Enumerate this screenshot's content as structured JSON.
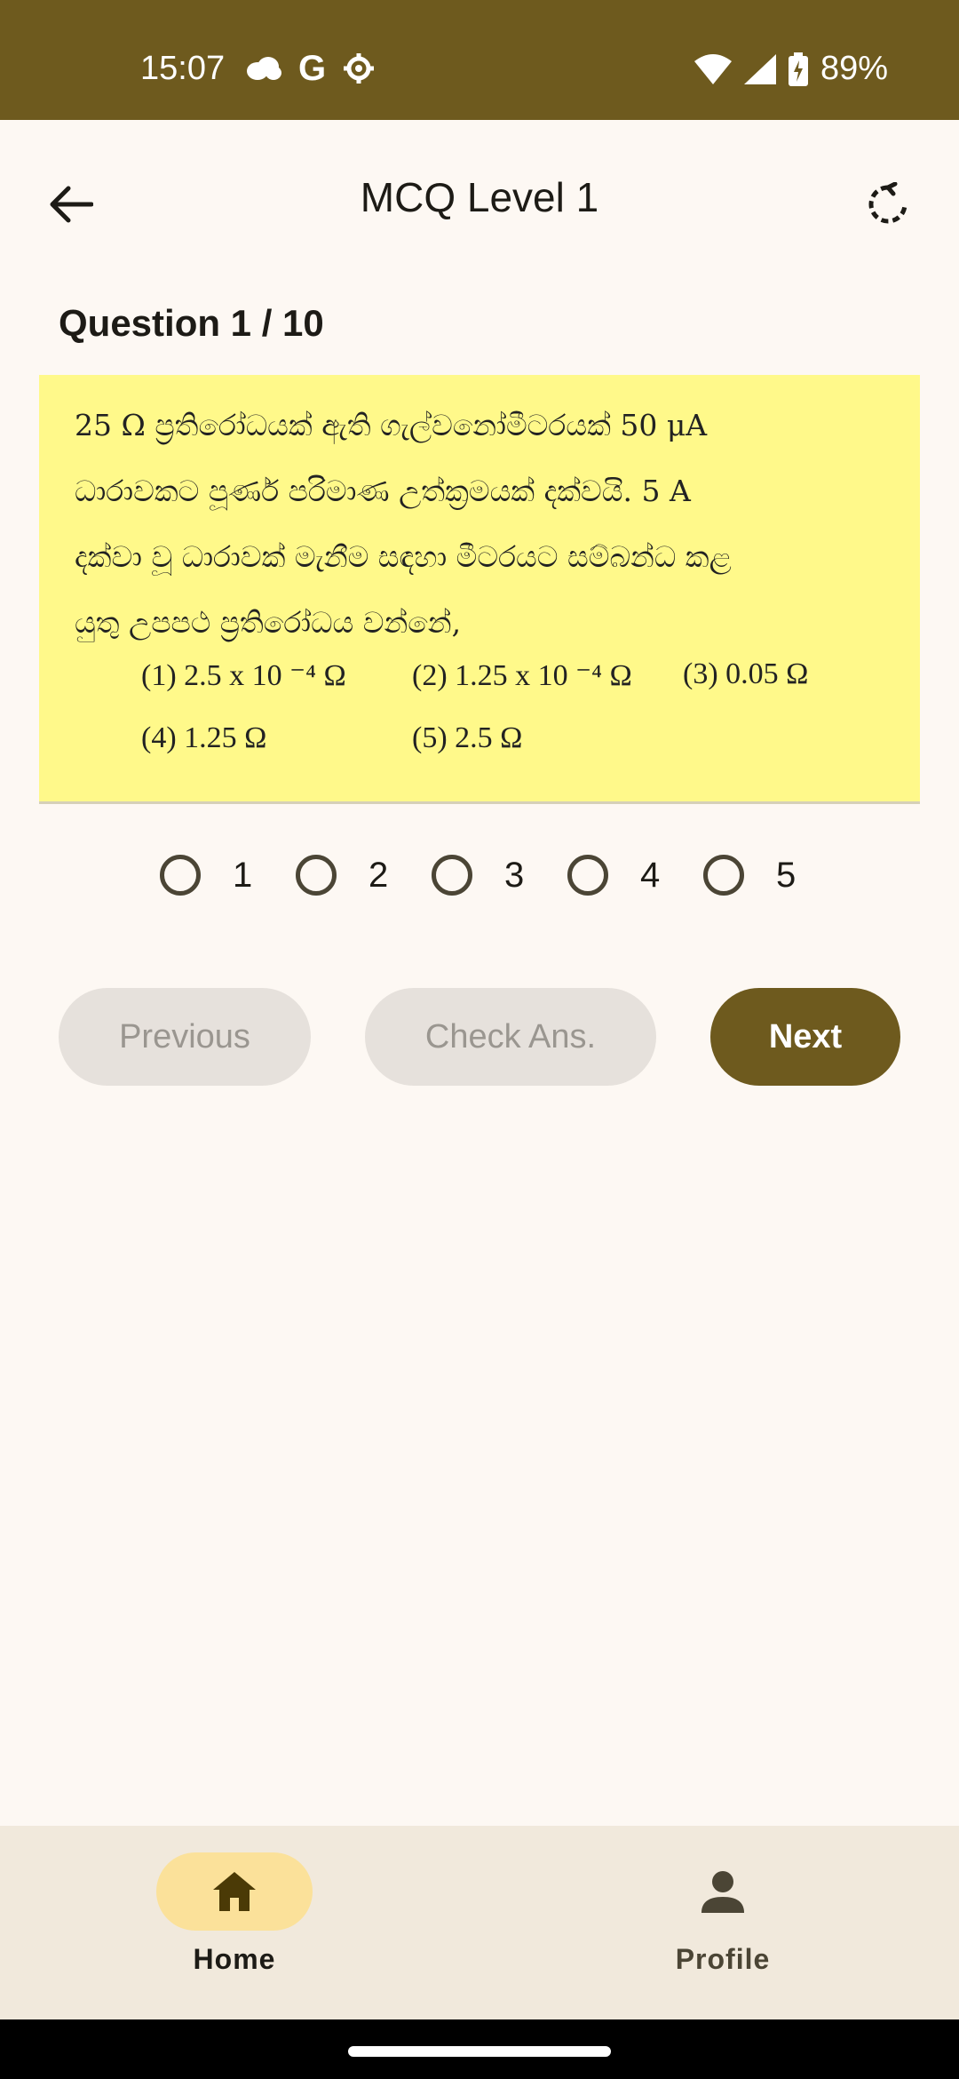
{
  "status_bar": {
    "time": "15:07",
    "icons": [
      "cloud-icon",
      "google-icon",
      "settings-icon"
    ],
    "battery": "89%"
  },
  "app_bar": {
    "title": "MCQ Level 1",
    "back_icon": "arrow-back-icon",
    "refresh_icon": "refresh-icon"
  },
  "question": {
    "label": "Question 1 / 10",
    "text_lines": [
      "25 Ω ප්‍රතිරෝධයක් ඇති ගැල්වනෝමීටරයක් 50 μA",
      "ධාරාවකට පූර්ණ පරිමාණ උත්ක්‍රමයක් දක්වයි. 5 A",
      "දක්වා වූ ධාරාවක් මැනීම සඳහා මීටරයට සම්බන්ධ කළ",
      "යුතු උපපථ ප්‍රතිරෝධය වන්නේ,"
    ],
    "options": [
      "(1)  2.5 x 10 ⁻⁴ Ω",
      "(2)  1.25 x 10 ⁻⁴ Ω",
      "(3)  0.05 Ω",
      "(4)  1.25 Ω",
      "(5)  2.5 Ω"
    ]
  },
  "answers": [
    "1",
    "2",
    "3",
    "4",
    "5"
  ],
  "buttons": {
    "previous": "Previous",
    "check": "Check Ans.",
    "next": "Next"
  },
  "bottom_nav": {
    "home": "Home",
    "profile": "Profile"
  }
}
